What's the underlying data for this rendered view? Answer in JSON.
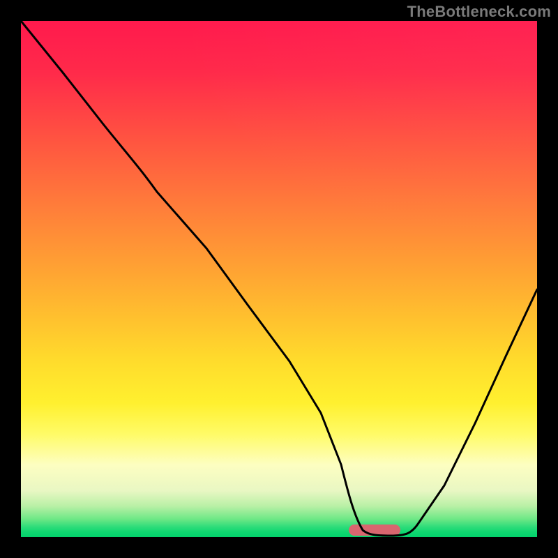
{
  "watermark": "TheBottleneck.com",
  "chart_data": {
    "type": "line",
    "title": "",
    "xlabel": "",
    "ylabel": "",
    "xlim": [
      0,
      100
    ],
    "ylim": [
      0,
      100
    ],
    "grid": false,
    "background_gradient": [
      "#ff1a4d",
      "#ff7d3a",
      "#ffdc2c",
      "#fdfec1",
      "#03d26c"
    ],
    "series": [
      {
        "name": "bottleneck-curve",
        "x": [
          0,
          8,
          16,
          22,
          28,
          36,
          44,
          52,
          58,
          62,
          65,
          68,
          72,
          76,
          82,
          88,
          94,
          100
        ],
        "values": [
          100,
          90,
          80,
          74,
          67,
          56,
          45,
          34,
          24,
          14,
          6,
          1,
          0,
          1,
          10,
          22,
          35,
          48
        ]
      }
    ],
    "marker": {
      "name": "optimal-range-pill",
      "shape": "rounded-rect",
      "color": "#d9666f",
      "x_range": [
        64,
        73
      ],
      "y": 0.5
    }
  }
}
